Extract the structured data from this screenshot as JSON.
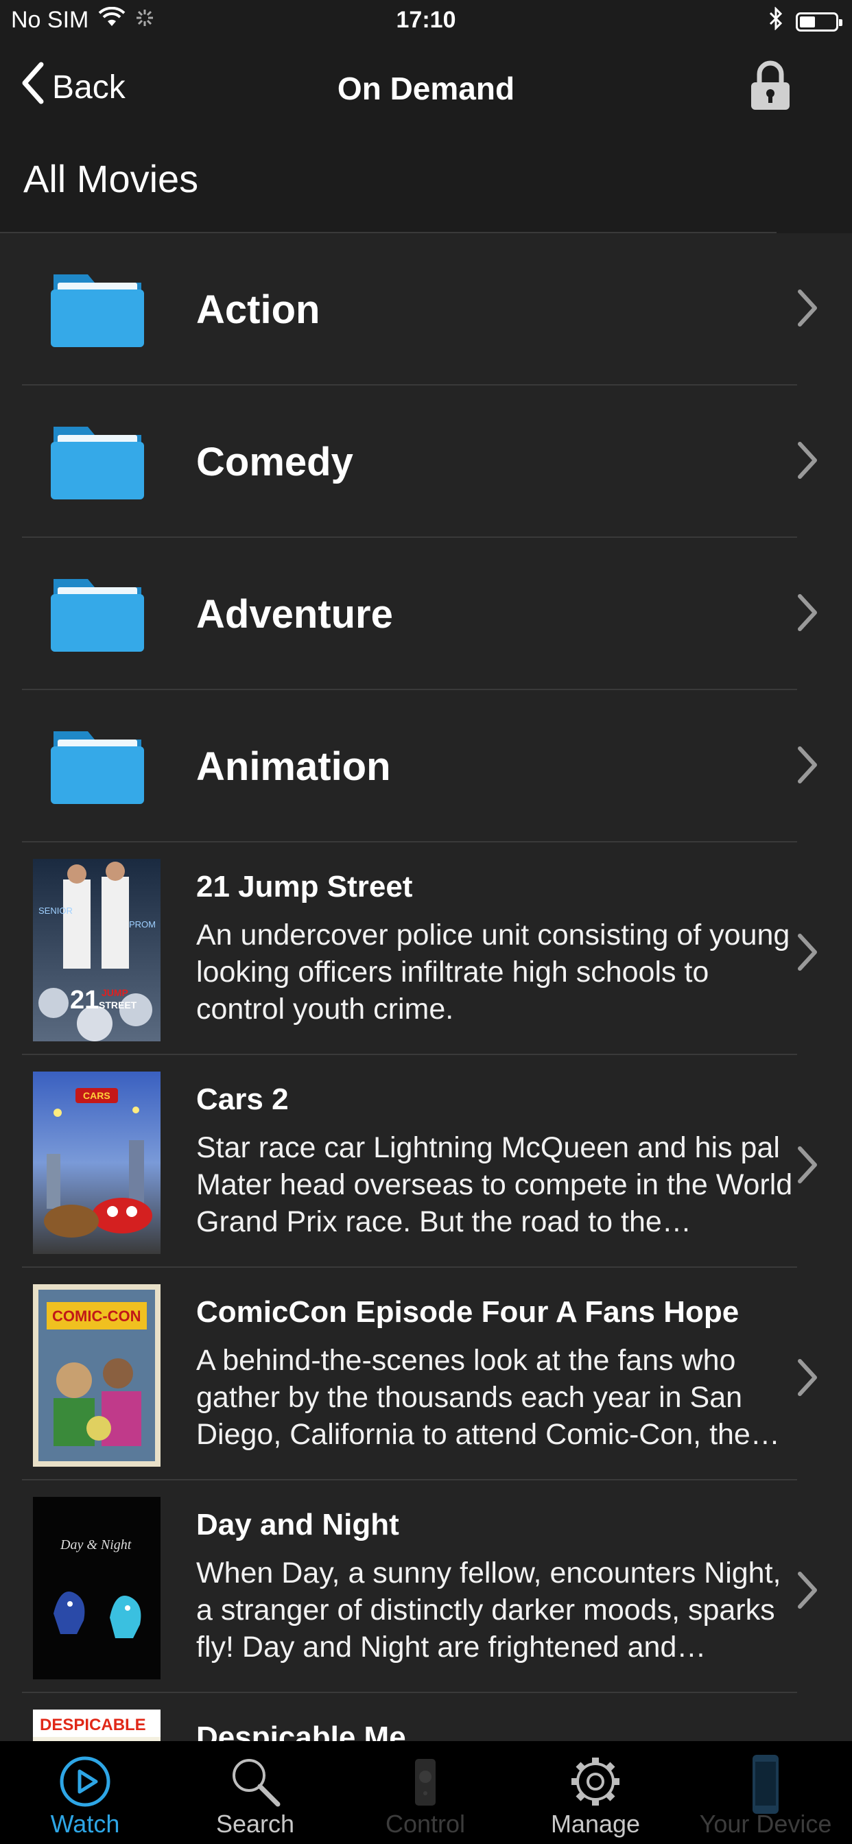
{
  "status_bar": {
    "carrier": "No SIM",
    "time": "17:10"
  },
  "nav": {
    "back_label": "Back",
    "title": "On Demand"
  },
  "section_title": "All Movies",
  "folders": [
    {
      "label": "Action"
    },
    {
      "label": "Comedy"
    },
    {
      "label": "Adventure"
    },
    {
      "label": "Animation"
    }
  ],
  "movies": [
    {
      "title": "21 Jump Street",
      "description": "An undercover police unit consisting of young looking officers infiltrate high schools to control youth crime.",
      "poster_text": [
        "SENIOR",
        "PROM",
        "21",
        "JUMP",
        "STREET"
      ]
    },
    {
      "title": "Cars 2",
      "description": "Star race car Lightning McQueen and his pal Mater head overseas to compete in the World Grand Prix race. But the road to the championship becomes rocky.",
      "poster_text": [
        "CARS"
      ]
    },
    {
      "title": "ComicCon Episode Four A Fans Hope",
      "description": "A behind-the-scenes look at the fans who gather by the thousands each year in San Diego, California to attend Comic-Con, the largest fan convention.",
      "poster_text": [
        "COMIC-CON"
      ]
    },
    {
      "title": "Day and Night",
      "description": "When Day, a sunny fellow, encounters Night, a stranger of distinctly darker moods, sparks fly! Day and Night are frightened and suspicious of each other.",
      "poster_text": [
        "Day & Night"
      ]
    },
    {
      "title": "Despicable Me",
      "description": "",
      "poster_text": [
        "DESPICABLE"
      ]
    }
  ],
  "tabs": [
    {
      "label": "Watch",
      "icon": "play-circle-icon",
      "state": "active"
    },
    {
      "label": "Search",
      "icon": "magnifier-icon",
      "state": "normal"
    },
    {
      "label": "Control",
      "icon": "remote-icon",
      "state": "disabled"
    },
    {
      "label": "Manage",
      "icon": "gear-icon",
      "state": "normal"
    },
    {
      "label": "Your Device",
      "icon": "phone-icon",
      "state": "disabled"
    }
  ],
  "colors": {
    "accent": "#2ea6e6",
    "folder": "#35a9e8",
    "background": "#242424",
    "header": "#1c1c1c"
  }
}
